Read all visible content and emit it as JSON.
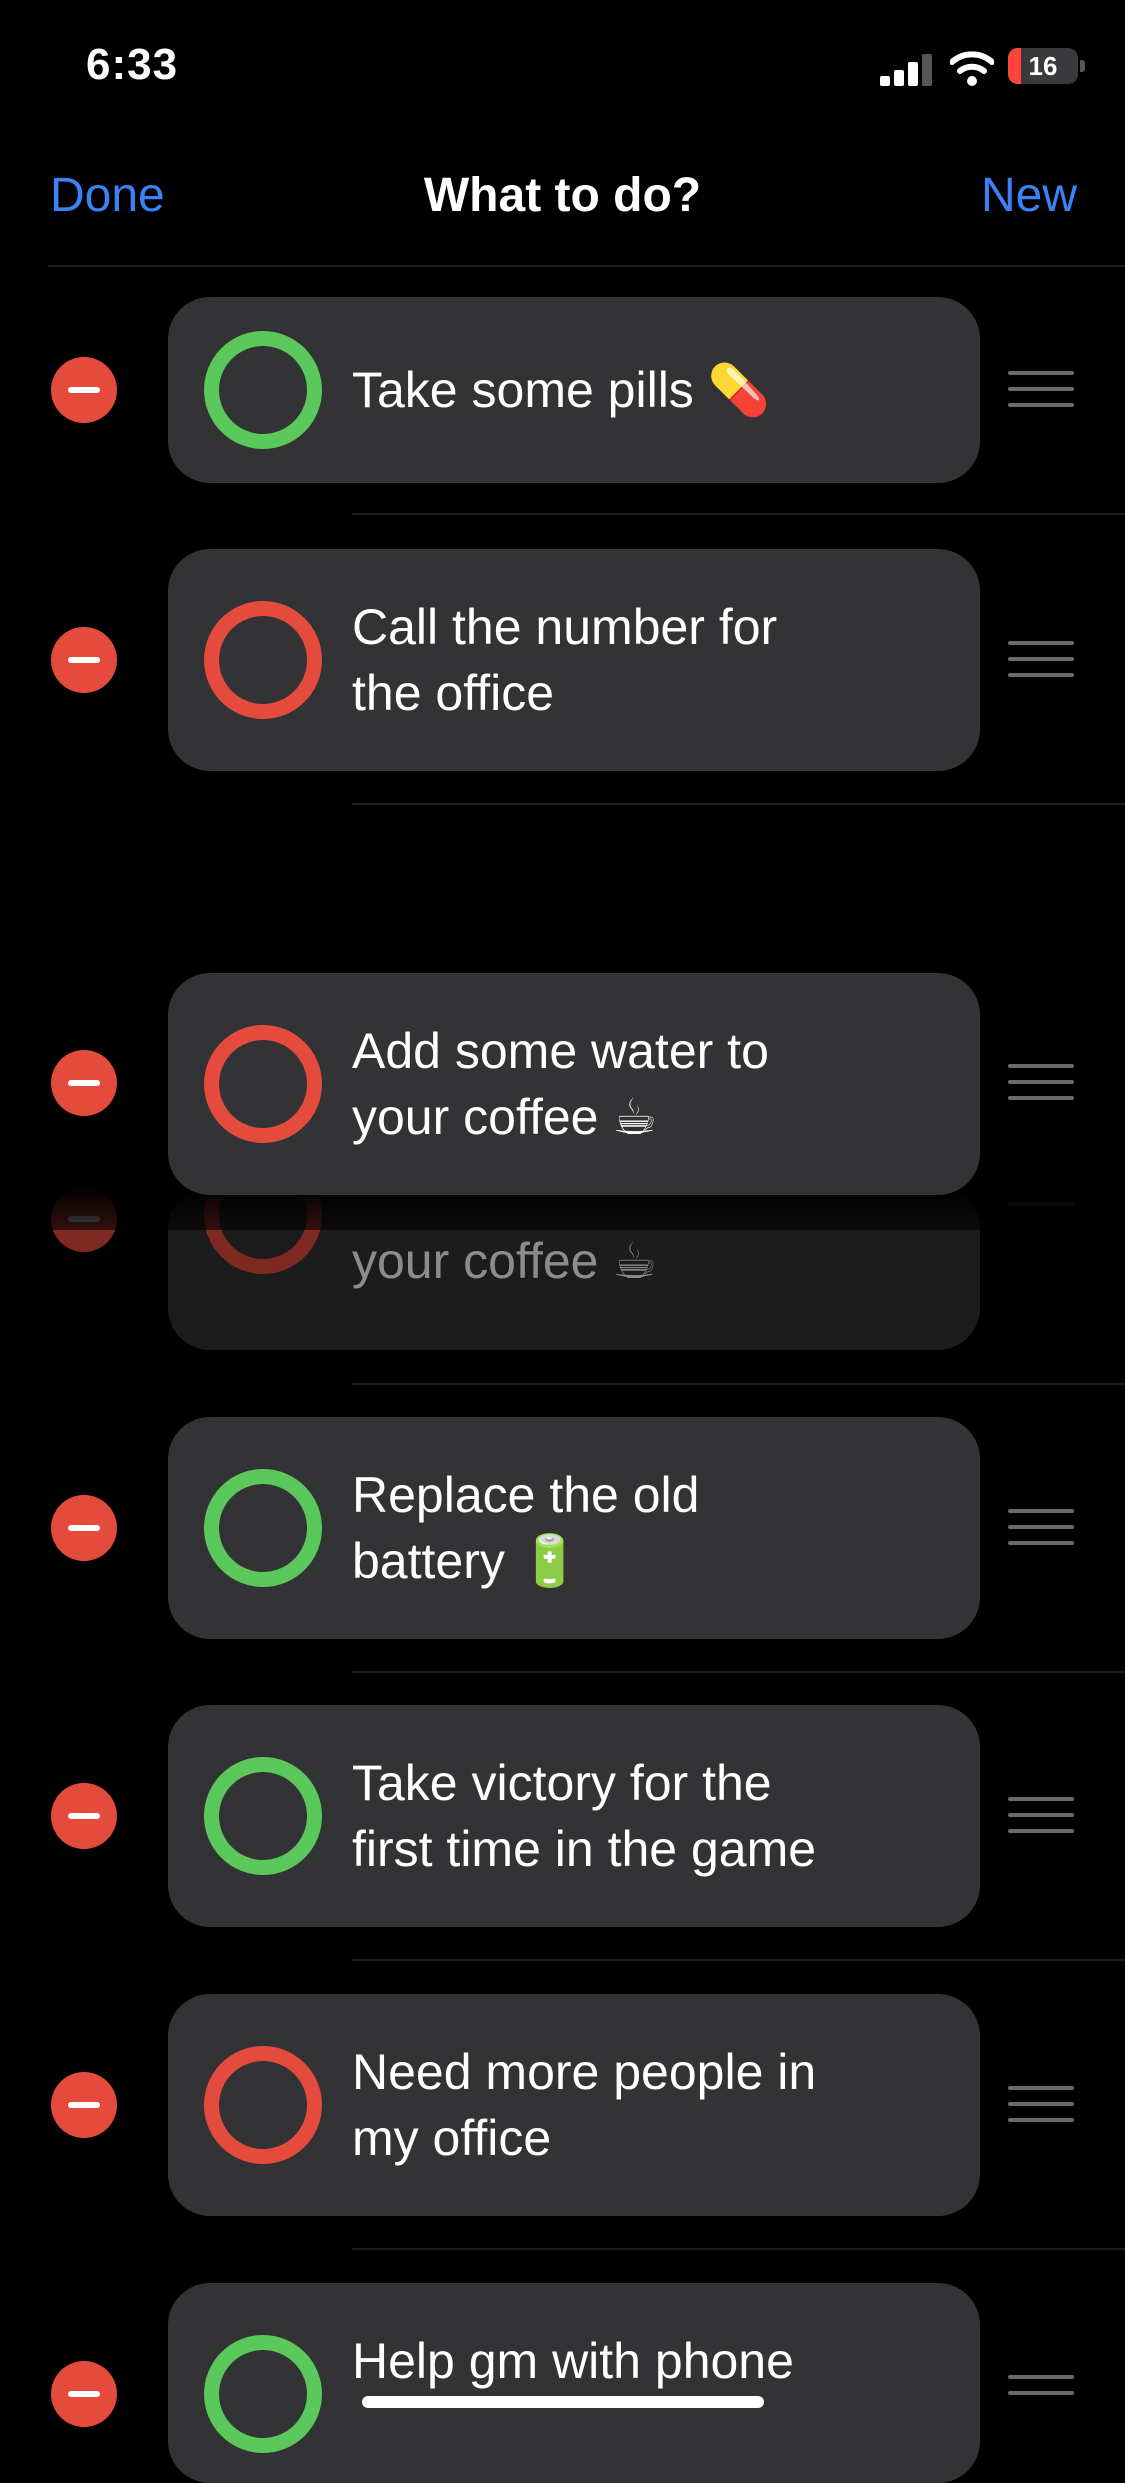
{
  "status_bar": {
    "time": "6:33",
    "battery": "16"
  },
  "nav": {
    "left": "Done",
    "title": "What to do?",
    "right": "New"
  },
  "items": [
    {
      "text": "Take some pills 💊",
      "status": "green"
    },
    {
      "text": "Call the number for\nthe office",
      "status": "red"
    },
    {
      "text": "Add some water to\nyour coffee ☕",
      "status": "red"
    },
    {
      "text": "your coffee ☕",
      "status": "red"
    },
    {
      "text": "Replace the old\nbattery 🔋",
      "status": "green"
    },
    {
      "text": "Take victory for the\nfirst time in the game",
      "status": "green"
    },
    {
      "text": "Need more people in\nmy office",
      "status": "red"
    },
    {
      "text": "Help gm with phone",
      "status": "green"
    }
  ],
  "colors": {
    "green": "#5ac85a",
    "red": "#e54b3c",
    "accent": "#3b82f6"
  }
}
